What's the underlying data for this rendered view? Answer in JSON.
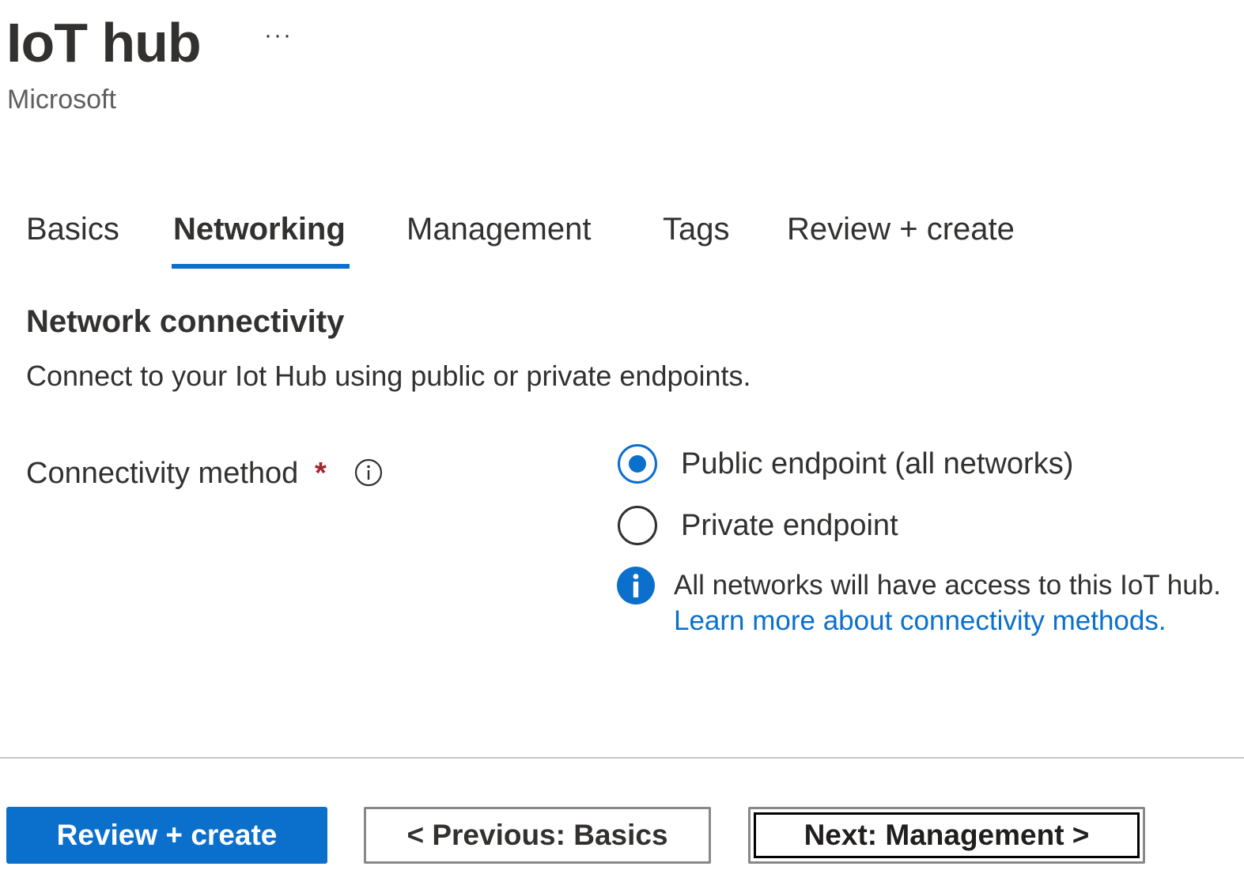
{
  "header": {
    "title": "IoT hub",
    "more_label": "···",
    "subtitle": "Microsoft"
  },
  "tabs": [
    {
      "label": "Basics",
      "active": false
    },
    {
      "label": "Networking",
      "active": true
    },
    {
      "label": "Management",
      "active": false
    },
    {
      "label": "Tags",
      "active": false
    },
    {
      "label": "Review + create",
      "active": false
    }
  ],
  "section": {
    "title": "Network connectivity",
    "description": "Connect to your Iot Hub using public or private endpoints."
  },
  "connectivity": {
    "label": "Connectivity method",
    "required_marker": "*",
    "options": [
      {
        "label": "Public endpoint (all networks)",
        "selected": true
      },
      {
        "label": "Private endpoint",
        "selected": false
      }
    ],
    "info_message": "All networks will have access to this IoT hub.",
    "info_link": "Learn more about connectivity methods."
  },
  "footer": {
    "primary_label": "Review + create",
    "previous_label": "< Previous: Basics",
    "next_label": "Next: Management >"
  },
  "colors": {
    "accent": "#0b6fcc",
    "required": "#a4262c",
    "text": "#323130",
    "muted": "#605e5c"
  },
  "icons": {
    "more": "more-icon",
    "info_outline": "info-outline-icon",
    "info_filled": "info-filled-icon"
  }
}
